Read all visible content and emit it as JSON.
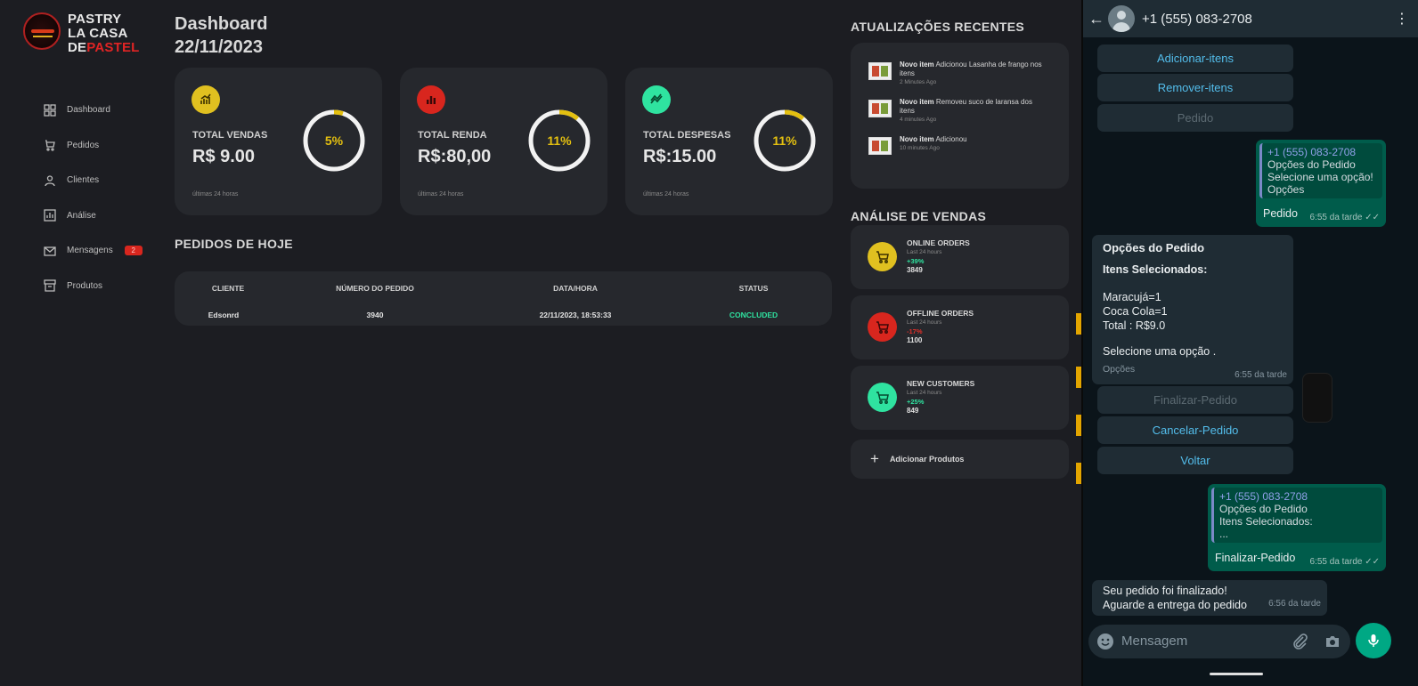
{
  "brand": {
    "line1": "PASTRY",
    "line2": "LA CASA",
    "line3a": "DE",
    "line3b": "PASTEL"
  },
  "header": {
    "title": "Dashboard",
    "date": "22/11/2023"
  },
  "sidebar": {
    "items": [
      {
        "label": "Dashboard",
        "icon": "grid-icon"
      },
      {
        "label": "Pedidos",
        "icon": "orders-icon"
      },
      {
        "label": "Clientes",
        "icon": "user-icon"
      },
      {
        "label": "Análise",
        "icon": "analytics-icon"
      },
      {
        "label": "Mensagens",
        "icon": "mail-icon",
        "badge": "2"
      },
      {
        "label": "Produtos",
        "icon": "box-icon"
      }
    ]
  },
  "cards": [
    {
      "label": "TOTAL VENDAS",
      "value": "R$ 9.00",
      "pct": "5%",
      "pct_value": 5,
      "foot": "últimas 24 horas",
      "color": "#e0c020",
      "icon": "bar-chart-icon"
    },
    {
      "label": "TOTAL RENDA",
      "value": "R$:80,00",
      "pct": "11%",
      "pct_value": 11,
      "foot": "últimas 24 horas",
      "color": "#d8261e",
      "icon": "stats-icon"
    },
    {
      "label": "TOTAL DESPESAS",
      "value": "R$:15.00",
      "pct": "11%",
      "pct_value": 11,
      "foot": "últimas 24 horas",
      "color": "#2fe3a0",
      "icon": "trend-icon"
    }
  ],
  "orders": {
    "title": "PEDIDOS DE HOJE",
    "columns": [
      "CLIENTE",
      "NÚMERO DO PEDIDO",
      "DATA/HORA",
      "STATUS"
    ],
    "rows": [
      [
        "Edsonrd",
        "3940",
        "22/11/2023, 18:53:33",
        "CONCLUDED"
      ]
    ]
  },
  "updates": {
    "title": "ATUALIZAÇÕES RECENTES",
    "items": [
      {
        "prefix": "Novo item",
        "text": " Adicionou Lasanha de frango nos itens",
        "time": "2 Minutes Ago"
      },
      {
        "prefix": "Novo item",
        "text": " Removeu suco de laransa dos itens",
        "time": "4 minutes Ago"
      },
      {
        "prefix": "Novo item",
        "text": " Adicionou",
        "time": "10 minutes Ago"
      }
    ]
  },
  "sales": {
    "title": "ANÁLISE DE VENDAS",
    "items": [
      {
        "title": "ONLINE ORDERS",
        "sub": "Last 24 hours",
        "pct": "+39%",
        "num": "3849",
        "color": "#e0c020",
        "pct_color": "#2fe3a0"
      },
      {
        "title": "OFFLINE ORDERS",
        "sub": "Last 24 hours",
        "pct": "-17%",
        "num": "1100",
        "color": "#d8261e",
        "pct_color": "#e0302a"
      },
      {
        "title": "NEW CUSTOMERS",
        "sub": "Last 24 hours",
        "pct": "+25%",
        "num": "849",
        "color": "#2fe3a0",
        "pct_color": "#2fe3a0"
      }
    ],
    "add_label": "Adicionar Produtos"
  },
  "phone": {
    "contact": "+1 (555) 083-2708",
    "buttons_top": [
      "Adicionar-itens",
      "Remover-itens",
      "Pedido"
    ],
    "msg_out1": {
      "quote_name": "+1 (555) 083-2708",
      "quote_lines": [
        "Opções do Pedido",
        "Selecione uma opção!",
        "Opções"
      ],
      "text": "Pedido",
      "time": "6:55 da tarde"
    },
    "msg_in1": {
      "title": "Opções do Pedido",
      "subtitle": "Itens Selecionados:",
      "lines": [
        "Maracujá=1",
        "Coca Cola=1",
        "Total : R$9.0"
      ],
      "prompt": "Selecione uma opção .",
      "footer": "Opções",
      "time": "6:55 da tarde"
    },
    "buttons_bottom": [
      "Finalizar-Pedido",
      "Cancelar-Pedido",
      "Voltar"
    ],
    "msg_out2": {
      "quote_name": "+1 (555) 083-2708",
      "quote_lines": [
        "Opções do Pedido",
        "Itens Selecionados:",
        "..."
      ],
      "text": "Finalizar-Pedido",
      "time": "6:55 da tarde"
    },
    "msg_in2": {
      "lines": [
        "Seu pedido foi finalizado!",
        "Aguarde a entrega do pedido"
      ],
      "time": "6:56 da tarde"
    },
    "composer_placeholder": "Mensagem"
  }
}
